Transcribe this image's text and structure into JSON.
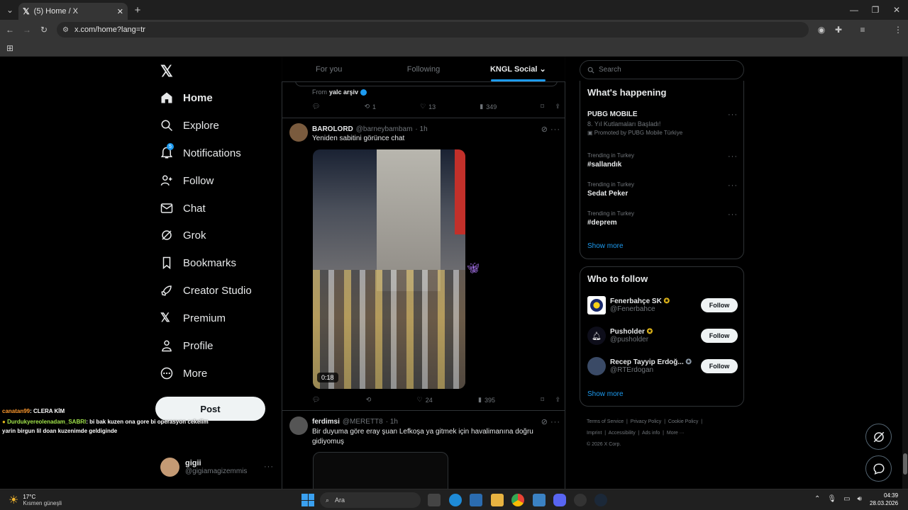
{
  "browser": {
    "tab_title": "(5) Home / X",
    "url": "x.com/home?lang=tr"
  },
  "nav": {
    "items": [
      {
        "label": "Home"
      },
      {
        "label": "Explore"
      },
      {
        "label": "Notifications"
      },
      {
        "label": "Follow"
      },
      {
        "label": "Chat"
      },
      {
        "label": "Grok"
      },
      {
        "label": "Bookmarks"
      },
      {
        "label": "Creator Studio"
      },
      {
        "label": "Premium"
      },
      {
        "label": "Profile"
      },
      {
        "label": "More"
      }
    ],
    "notifications_badge": "5",
    "post_label": "Post",
    "account_name": "gigii",
    "account_handle": "@gigiamagizemmis"
  },
  "chat_overlay": [
    {
      "user": "canatan99",
      "text": ": CLERA KİM"
    },
    {
      "user": "Durdukyereolenadam_SABRI",
      "text": ": bi bak kuzen ona gore bi operasyon cekelim"
    },
    {
      "user": "",
      "text": "yarin birgun lil doan kuzenimde geldiginde"
    }
  ],
  "feed": {
    "tabs": [
      "For you",
      "Following",
      "KNGL Social"
    ],
    "prev_post": {
      "from_prefix": "From",
      "from_name": "yalc arşiv",
      "retweets": "1",
      "likes": "13",
      "views": "349"
    },
    "post1": {
      "name": "BAROLORD",
      "handle": "@barneybambam",
      "time": "· 1h",
      "text": "Yeniden sabitini görünce chat",
      "video_duration": "0:18",
      "likes": "24",
      "views": "395"
    },
    "post2": {
      "name": "ferdimsi",
      "handle": "@MERETT8",
      "time": "· 1h",
      "text": "Bir duyuma göre eray şuan Lefkoşa ya gitmek için havalimanına doğru gidiyomuş"
    }
  },
  "sidebar": {
    "search_placeholder": "Search",
    "whats_happening": "What's happening",
    "trends": [
      {
        "meta": "",
        "name": "PUBG MOBILE",
        "sub": "8. Yıl Kutlamaları Başladı!",
        "promo": "Promoted by PUBG Mobile Türkiye"
      },
      {
        "meta": "Trending in Turkey",
        "name": "#sallandık"
      },
      {
        "meta": "Trending in Turkey",
        "name": "Sedat Peker"
      },
      {
        "meta": "Trending in Turkey",
        "name": "#deprem"
      }
    ],
    "show_more": "Show more",
    "who_to_follow": "Who to follow",
    "follows": [
      {
        "name": "Fenerbahçe SK",
        "handle": "@Fenerbahce",
        "button": "Follow"
      },
      {
        "name": "Pusholder",
        "handle": "@pusholder",
        "button": "Follow"
      },
      {
        "name": "Recep Tayyip Erdoğ...",
        "handle": "@RTErdogan",
        "button": "Follow"
      }
    ],
    "show_more_2": "Show more",
    "footer": {
      "line1": [
        "Terms of Service",
        "Privacy Policy",
        "Cookie Policy"
      ],
      "line2": [
        "Imprint",
        "Accessibility",
        "Ads info",
        "More ···"
      ],
      "copyright": "© 2026 X Corp."
    }
  },
  "taskbar": {
    "weather_temp": "17°C",
    "weather_desc": "Kısmen güneşli",
    "search_label": "Ara",
    "time": "04:39",
    "date": "28.03.2026"
  },
  "colors": {
    "accent": "#1d9bf0",
    "verified_gold": "#e2b719"
  }
}
